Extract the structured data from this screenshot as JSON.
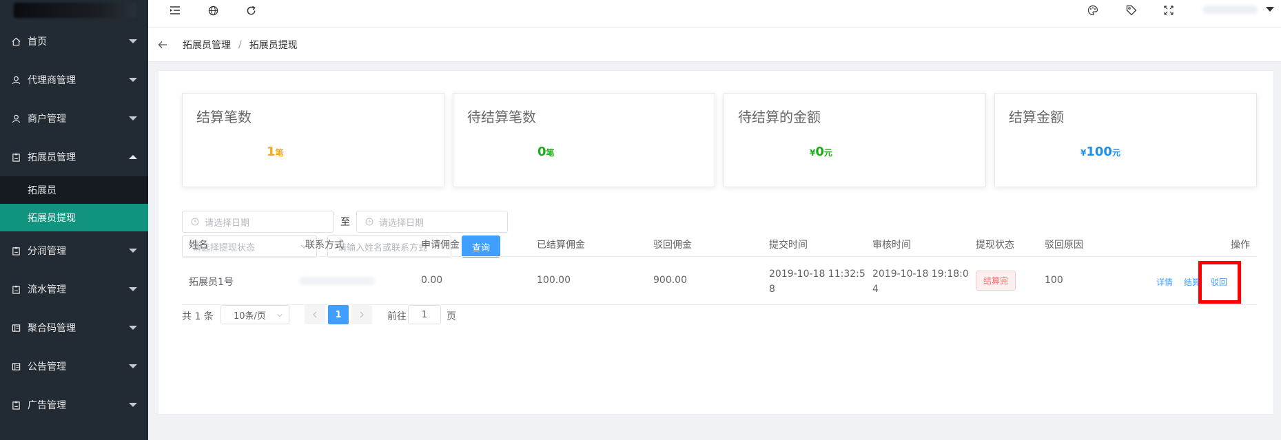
{
  "sidebar": {
    "items": [
      {
        "label": "首页",
        "icon": "home-icon"
      },
      {
        "label": "代理商管理",
        "icon": "user-icon"
      },
      {
        "label": "商户管理",
        "icon": "user-icon"
      },
      {
        "label": "拓展员管理",
        "icon": "clipboard-icon",
        "expanded": true
      },
      {
        "label": "分润管理",
        "icon": "clipboard-icon"
      },
      {
        "label": "流水管理",
        "icon": "clipboard-icon"
      },
      {
        "label": "聚合码管理",
        "icon": "list-icon"
      },
      {
        "label": "公告管理",
        "icon": "list-icon"
      },
      {
        "label": "广告管理",
        "icon": "clipboard-icon"
      }
    ],
    "submenu": [
      {
        "label": "拓展员",
        "active": false
      },
      {
        "label": "拓展员提现",
        "active": true
      }
    ],
    "active_color": "#10937f"
  },
  "breadcrumb": {
    "parent": "拓展员管理",
    "separator": "/",
    "current": "拓展员提现"
  },
  "stats": [
    {
      "title": "结算笔数",
      "currency": "",
      "value": "1",
      "unit": "笔",
      "color": "#f5a623"
    },
    {
      "title": "待结算笔数",
      "currency": "",
      "value": "0",
      "unit": "笔",
      "color": "#1aad19"
    },
    {
      "title": "待结算的金额",
      "currency": "¥",
      "value": "0",
      "unit": "元",
      "color": "#1aad19"
    },
    {
      "title": "结算金额",
      "currency": "¥",
      "value": "100",
      "unit": "元",
      "color": "#1e8fe8"
    }
  ],
  "filters": {
    "start_date_placeholder": "请选择日期",
    "to_label": "至",
    "end_date_placeholder": "请选择日期",
    "status_placeholder": "请选择提现状态",
    "keyword_placeholder": "请输入姓名或联系方式",
    "query_label": "查询"
  },
  "table": {
    "headers": [
      "姓名",
      "联系方式",
      "申请佣金",
      "已结算佣金",
      "驳回佣金",
      "提交时间",
      "审核时间",
      "提现状态",
      "驳回原因",
      "操作"
    ],
    "rows": [
      {
        "name": "拓展员1号",
        "apply": "0.00",
        "settled": "100.00",
        "rejected": "900.00",
        "submit_time_1": "2019-10-18 11:32:5",
        "submit_time_2": "8",
        "audit_time_1": "2019-10-18 19:18:0",
        "audit_time_2": "4",
        "status": "结算完",
        "reason": "100",
        "actions": {
          "detail": "详情",
          "settle": "结算",
          "reject": "驳回"
        }
      }
    ]
  },
  "pagination": {
    "total": "共 1 条",
    "page_size": "10条/页",
    "current_page": "1",
    "goto_label": "前往",
    "goto_value": "1",
    "page_suffix": "页"
  }
}
